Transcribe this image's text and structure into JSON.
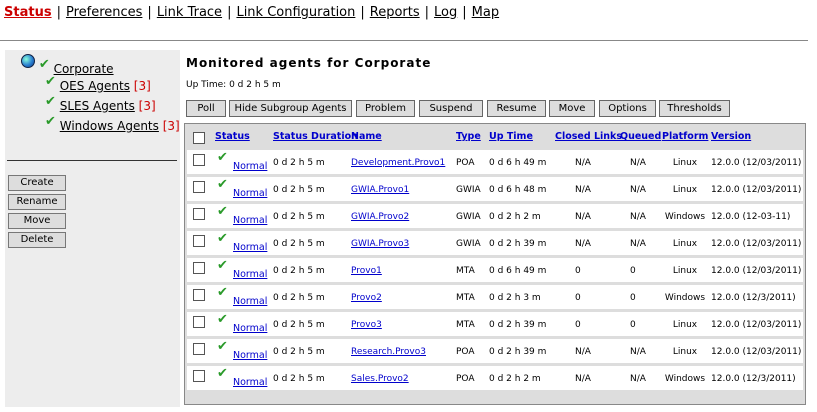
{
  "topnav": [
    "Status",
    "Preferences",
    "Link Trace",
    "Link Configuration",
    "Reports",
    "Log",
    "Map"
  ],
  "tree": {
    "root": "Corporate",
    "children": [
      {
        "label": "OES Agents",
        "count": "[3]"
      },
      {
        "label": "SLES Agents",
        "count": "[3]"
      },
      {
        "label": "Windows Agents",
        "count": "[3]"
      }
    ]
  },
  "left_buttons": [
    "Create",
    "Rename",
    "Move",
    "Delete"
  ],
  "main": {
    "title": "Monitored agents for Corporate",
    "uptime": "Up Time: 0 d 2 h 5 m",
    "buttons": [
      "Poll",
      "Hide Subgroup Agents",
      "Problem",
      "Suspend",
      "Resume",
      "Move",
      "Options",
      "Thresholds"
    ],
    "columns": [
      "Status",
      "Status Duration",
      "Name",
      "Type",
      "Up Time",
      "Closed Links",
      "Queued",
      "Platform",
      "Version"
    ],
    "rows": [
      {
        "status": "Normal",
        "duration": "0 d 2 h 5 m",
        "name": "Development.Provo1",
        "type": "POA",
        "uptime": "0 d 6 h 49 m",
        "closed": "N/A",
        "queued": "N/A",
        "platform": "Linux",
        "version": "12.0.0 (12/03/2011)"
      },
      {
        "status": "Normal",
        "duration": "0 d 2 h 5 m",
        "name": "GWIA.Provo1",
        "type": "GWIA",
        "uptime": "0 d 6 h 48 m",
        "closed": "N/A",
        "queued": "N/A",
        "platform": "Linux",
        "version": "12.0.0 (12/03/2011)"
      },
      {
        "status": "Normal",
        "duration": "0 d 2 h 5 m",
        "name": "GWIA.Provo2",
        "type": "GWIA",
        "uptime": "0 d 2 h 2 m",
        "closed": "N/A",
        "queued": "N/A",
        "platform": "Windows",
        "version": "12.0.0 (12-03-11)"
      },
      {
        "status": "Normal",
        "duration": "0 d 2 h 5 m",
        "name": "GWIA.Provo3",
        "type": "GWIA",
        "uptime": "0 d 2 h 39 m",
        "closed": "N/A",
        "queued": "N/A",
        "platform": "Linux",
        "version": "12.0.0 (12/03/2011)"
      },
      {
        "status": "Normal",
        "duration": "0 d 2 h 5 m",
        "name": "Provo1",
        "type": "MTA",
        "uptime": "0 d 6 h 49 m",
        "closed": "0",
        "queued": "0",
        "platform": "Linux",
        "version": "12.0.0 (12/03/2011)"
      },
      {
        "status": "Normal",
        "duration": "0 d 2 h 5 m",
        "name": "Provo2",
        "type": "MTA",
        "uptime": "0 d 2 h 3 m",
        "closed": "0",
        "queued": "0",
        "platform": "Windows",
        "version": "12.0.0 (12/3/2011)"
      },
      {
        "status": "Normal",
        "duration": "0 d 2 h 5 m",
        "name": "Provo3",
        "type": "MTA",
        "uptime": "0 d 2 h 39 m",
        "closed": "0",
        "queued": "0",
        "platform": "Linux",
        "version": "12.0.0 (12/03/2011)"
      },
      {
        "status": "Normal",
        "duration": "0 d 2 h 5 m",
        "name": "Research.Provo3",
        "type": "POA",
        "uptime": "0 d 2 h 39 m",
        "closed": "N/A",
        "queued": "N/A",
        "platform": "Linux",
        "version": "12.0.0 (12/03/2011)"
      },
      {
        "status": "Normal",
        "duration": "0 d 2 h 5 m",
        "name": "Sales.Provo2",
        "type": "POA",
        "uptime": "0 d 2 h 2 m",
        "closed": "N/A",
        "queued": "N/A",
        "platform": "Windows",
        "version": "12.0.0 (12/3/2011)"
      }
    ]
  },
  "colors": {
    "active_nav": "#cc0000",
    "check": "#2a9a2a",
    "link": "#0000cc"
  }
}
